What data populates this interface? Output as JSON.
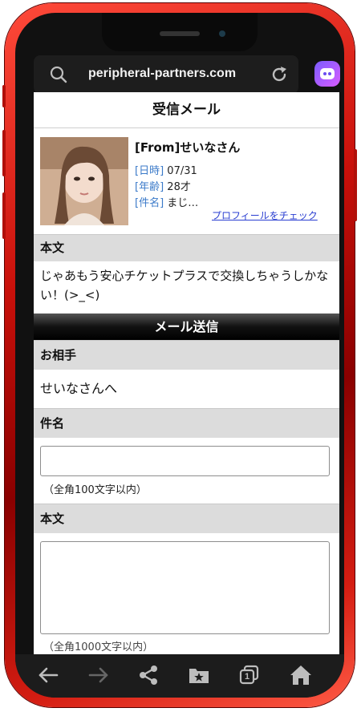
{
  "browser": {
    "url": "peripheral-partners.com"
  },
  "page": {
    "title": "受信メール",
    "message": {
      "from": "[From]せいなさん",
      "date_label": "[日時]",
      "date_value": "07/31",
      "age_label": "[年齢]",
      "age_value": "28才",
      "subject_label": "[件名]",
      "subject_value": "まじ…",
      "profile_link": "プロフィールをチェック"
    },
    "body_header": "本文",
    "body_text": "じゃあもう安心チケットプラスで交換しちゃうしかない！(>_<)",
    "send_section": {
      "title": "メール送信",
      "recipient_header": "お相手",
      "recipient_value": "せいなさんへ",
      "subject_header": "件名",
      "subject_input_value": "",
      "subject_hint": "（全角100文字以内）",
      "body_header": "本文",
      "body_input_value": "",
      "body_hint": "（全角1000文字以内）"
    }
  },
  "bottom_nav": {
    "tab_count": "1",
    "icons": [
      "back-arrow-icon",
      "forward-arrow-icon",
      "share-icon",
      "bookmark-folder-icon",
      "tabs-icon",
      "home-icon"
    ]
  },
  "colors": {
    "phone_frame": "#c8100a",
    "meta_label": "#3b7ac9",
    "link": "#2a3ed1",
    "section_header_bg": "#dcdcdc",
    "send_bar_bg": "#111111"
  }
}
